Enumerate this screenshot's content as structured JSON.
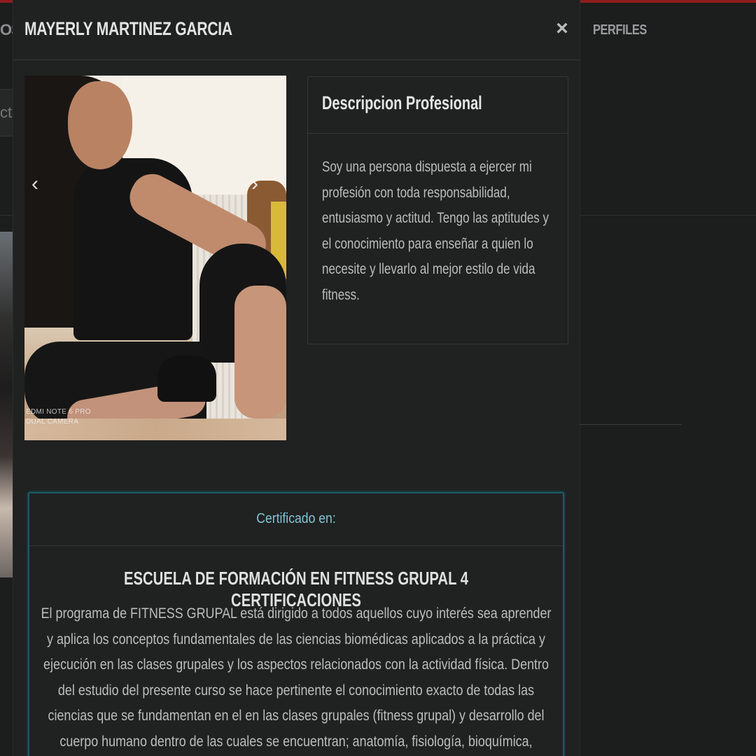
{
  "background": {
    "nav_left_fragment": "OS",
    "nav_right_item": "PERFILES",
    "left_panel_fragment": "cto"
  },
  "modal": {
    "title": "MAYERLY MARTINEZ GARCIA",
    "close_label": "×"
  },
  "carousel": {
    "prev_icon": "‹",
    "next_icon": "›",
    "photo_watermark_line1": "EDMI NOTE 6 PRO",
    "photo_watermark_line2": "DUAL CAMERA"
  },
  "description": {
    "title": "Descripcion Profesional",
    "text": "Soy una persona dispuesta a ejercer mi profesión con toda responsabilidad, entusiasmo y actitud. Tengo las aptitudes y el conocimiento para enseñar a quien lo necesite y llevarlo al mejor estilo de vida fitness."
  },
  "certificate": {
    "label": "Certificado en:",
    "title": "ESCUELA DE FORMACIÓN EN FITNESS GRUPAL 4 CERTIFICACIONES",
    "text": "El programa de FITNESS GRUPAL está dirigido a todos aquellos cuyo interés sea aprender y aplica los conceptos fundamentales de las ciencias biomédicas aplicados a la práctica y ejecución en las clases grupales y los aspectos relacionados con la actividad física. Dentro del estudio del presente curso se hace pertinente el conocimiento exacto de todas las ciencias que se fundamentan en el en las clases grupales (fitness grupal) y desarrollo del cuerpo humano dentro de las cuales se encuentran; anatomía, fisiología, bioquímica, biomecánica, psicología, entre otras,"
  },
  "colors": {
    "background": "#1c1d1d",
    "modal": "#202121",
    "accent_red": "#8f1c1c",
    "cert_border": "#1e5b63",
    "cert_label": "#7fc7d6"
  }
}
